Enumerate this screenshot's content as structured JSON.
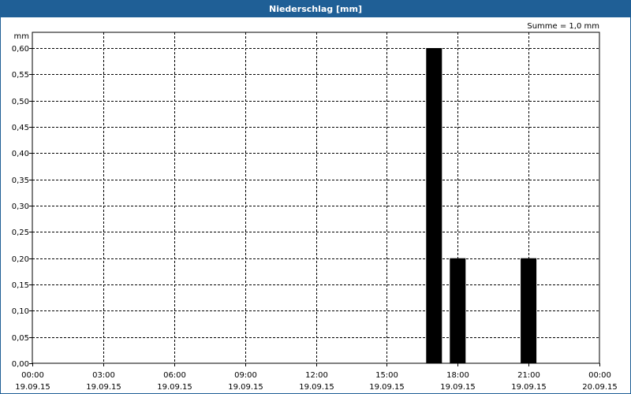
{
  "window": {
    "title": "Niederschlag [mm]"
  },
  "chart_data": {
    "type": "bar",
    "title": "Niederschlag [mm]",
    "ylabel": "mm",
    "ylim": [
      0,
      0.6
    ],
    "y_ticks": [
      "0,00",
      "0,05",
      "0,10",
      "0,15",
      "0,20",
      "0,25",
      "0,30",
      "0,35",
      "0,40",
      "0,45",
      "0,50",
      "0,55",
      "0,60"
    ],
    "x_ticks": [
      {
        "time": "00:00",
        "date": "19.09.15"
      },
      {
        "time": "03:00",
        "date": "19.09.15"
      },
      {
        "time": "06:00",
        "date": "19.09.15"
      },
      {
        "time": "09:00",
        "date": "19.09.15"
      },
      {
        "time": "12:00",
        "date": "19.09.15"
      },
      {
        "time": "15:00",
        "date": "19.09.15"
      },
      {
        "time": "18:00",
        "date": "19.09.15"
      },
      {
        "time": "21:00",
        "date": "19.09.15"
      },
      {
        "time": "00:00",
        "date": "20.09.15"
      }
    ],
    "bars": [
      {
        "time": "19.09.15 17:00",
        "value": 0.6
      },
      {
        "time": "19.09.15 18:00",
        "value": 0.2
      },
      {
        "time": "19.09.15 21:00",
        "value": 0.2
      }
    ],
    "summary": "Summe = 1,0 mm",
    "grid": true,
    "bar_color": "#000000"
  }
}
